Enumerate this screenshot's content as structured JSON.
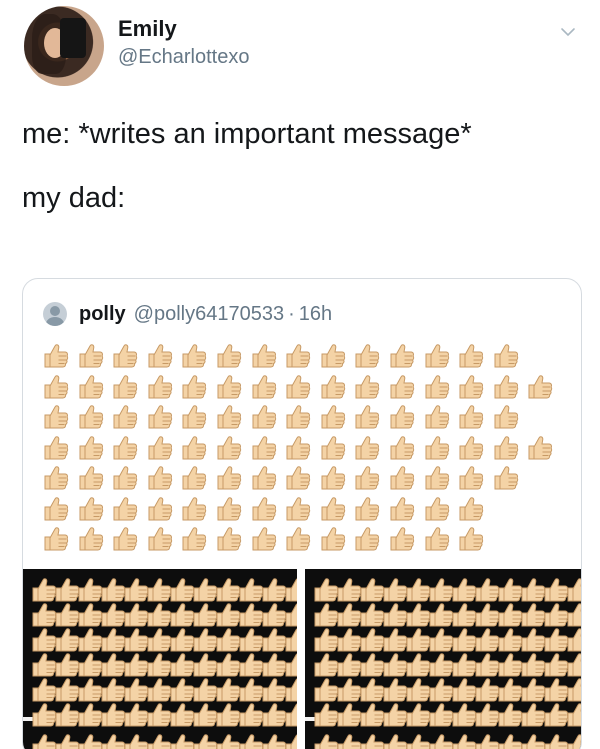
{
  "tweet": {
    "author_name": "Emily",
    "author_handle": "@Echarlottexo",
    "lines": [
      "me: *writes an important message*",
      "my dad:"
    ]
  },
  "quoted": {
    "name": "polly",
    "handle": "@polly64170533",
    "separator": "·",
    "time": "16h",
    "emoji": "thumbs-up",
    "row_counts": [
      14,
      15,
      14,
      15,
      14,
      13,
      13
    ]
  },
  "colors": {
    "thumb_fill": "#f4d3a6",
    "thumb_stroke": "#c79a66",
    "media_bg": "#0d0d0d"
  }
}
